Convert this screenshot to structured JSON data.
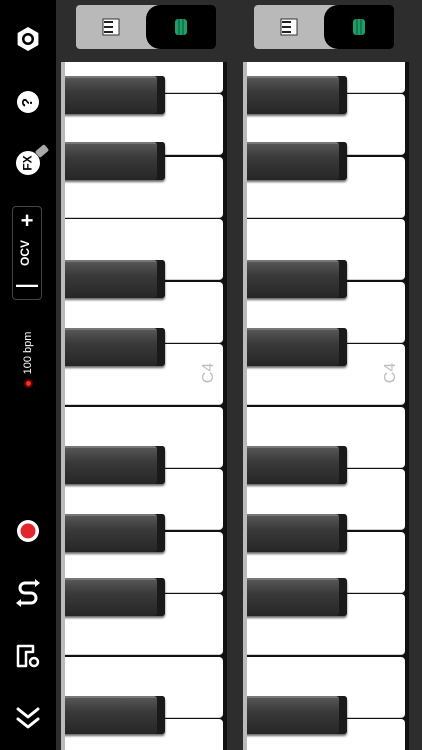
{
  "sidebar": {
    "octave": {
      "label": "OCV",
      "plus": "+",
      "minus": "—"
    },
    "tempo": {
      "label": "100 bpm"
    },
    "icons": [
      "settings-icon",
      "help-icon",
      "fx-icon",
      "record-icon",
      "loop-icon",
      "chord-icon",
      "collapse-icon"
    ],
    "fx_label": "FX",
    "help_label": "?"
  },
  "keyboards": [
    {
      "mode_selected": "drum",
      "c_label": "C4"
    },
    {
      "mode_selected": "drum",
      "c_label": "C4"
    }
  ],
  "colors": {
    "record": "#e3262b",
    "accent_green": "#1f9e6a"
  }
}
